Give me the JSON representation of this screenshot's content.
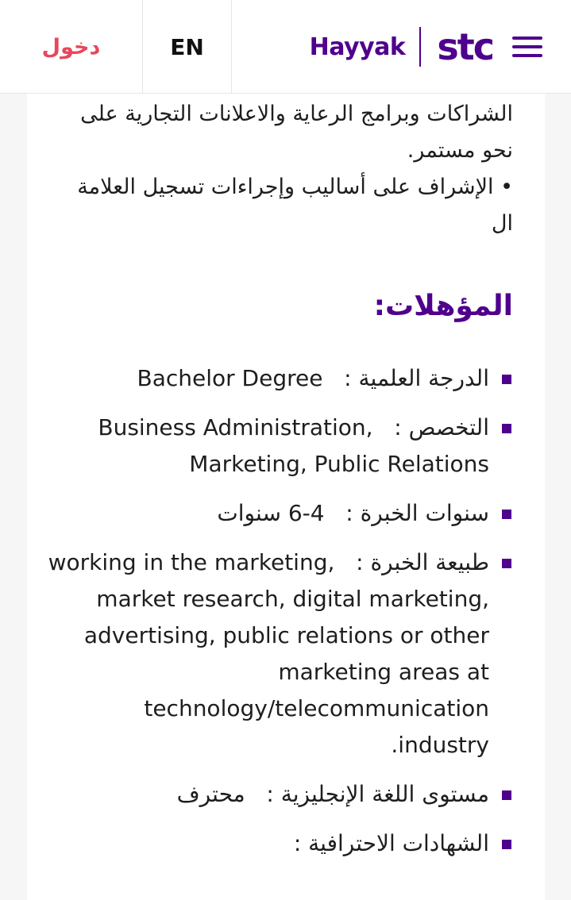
{
  "header": {
    "login_label": "دخول",
    "lang_label": "EN",
    "brand_name": "Hayyak",
    "logo_text": "stc",
    "menu_icon": "hamburger-icon"
  },
  "colors": {
    "brand": "#4f008c",
    "login": "#e8475b"
  },
  "content": {
    "para_top": "الشراكات وبرامج الرعاية والاعلانات التجارية على نحو مستمر.",
    "para_bullet": "• الإشراف على أساليب وإجراءات تسجيل العلامة ال",
    "qualifications_title": "المؤهلات:",
    "items": [
      {
        "label": "الدرجة العلمية",
        "value": "Bachelor Degree"
      },
      {
        "label": "التخصص",
        "value": "Business Administration, Marketing, Public Relations"
      },
      {
        "label": "سنوات الخبرة",
        "value": "4-6 سنوات"
      },
      {
        "label": "طبيعة الخبرة",
        "value": "working in the marketing, market research, digital marketing, advertising, public relations or other marketing areas at technology/telecommunication industry."
      },
      {
        "label": "مستوى اللغة الإنجليزية",
        "value": "محترف"
      },
      {
        "label": "الشهادات الاحترافية",
        "value": ""
      }
    ]
  }
}
